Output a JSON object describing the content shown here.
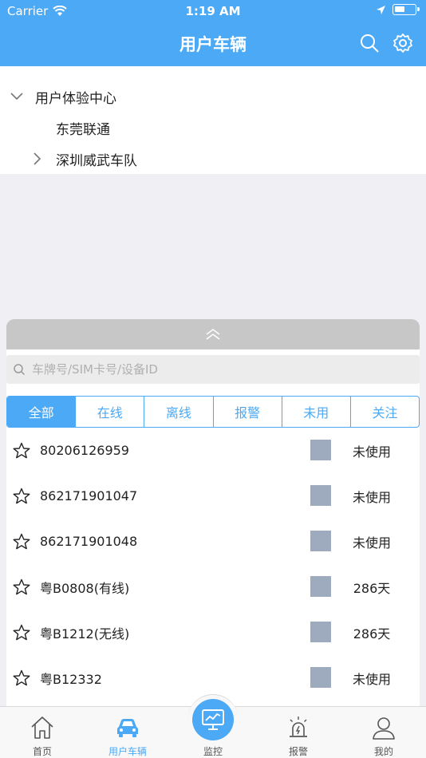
{
  "status": {
    "carrier": "Carrier",
    "time": "1:19 AM"
  },
  "nav": {
    "title": "用户车辆"
  },
  "tree": [
    {
      "label": "用户体验中心",
      "expanded": true
    },
    {
      "label": "东莞联通"
    },
    {
      "label": "深圳威武车队",
      "collapsed": true
    }
  ],
  "search": {
    "placeholder": "车牌号/SIM卡号/设备ID"
  },
  "filters": [
    "全部",
    "在线",
    "离线",
    "报警",
    "未用",
    "关注"
  ],
  "vehicles": [
    {
      "name": "80206126959",
      "status": "未使用"
    },
    {
      "name": "862171901047",
      "status": "未使用"
    },
    {
      "name": "862171901048",
      "status": "未使用"
    },
    {
      "name": "粤B0808(有线)",
      "status": "286天"
    },
    {
      "name": "粤B1212(无线)",
      "status": "286天"
    },
    {
      "name": "粤B12332",
      "status": "未使用"
    }
  ],
  "tabs": [
    {
      "label": "首页",
      "icon": "home-icon"
    },
    {
      "label": "用户车辆",
      "icon": "car-icon"
    },
    {
      "label": "监控",
      "icon": "monitor-icon"
    },
    {
      "label": "报警",
      "icon": "alarm-icon"
    },
    {
      "label": "我的",
      "icon": "person-icon"
    }
  ],
  "colors": {
    "accent": "#4ca9f5",
    "box": "#9eaabd",
    "handle": "#c7c7c7"
  }
}
